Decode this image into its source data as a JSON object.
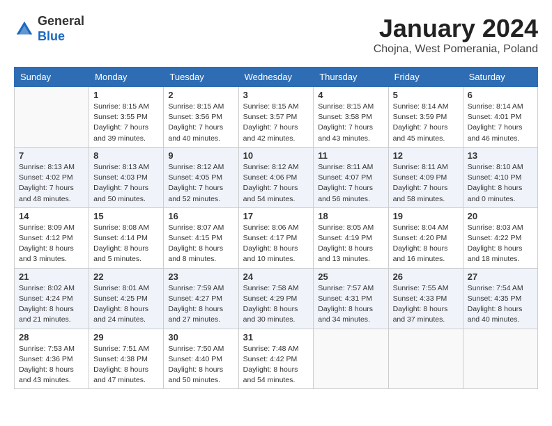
{
  "header": {
    "logo_line1": "General",
    "logo_line2": "Blue",
    "month_title": "January 2024",
    "subtitle": "Chojna, West Pomerania, Poland"
  },
  "weekdays": [
    "Sunday",
    "Monday",
    "Tuesday",
    "Wednesday",
    "Thursday",
    "Friday",
    "Saturday"
  ],
  "weeks": [
    [
      {
        "day": "",
        "info": ""
      },
      {
        "day": "1",
        "info": "Sunrise: 8:15 AM\nSunset: 3:55 PM\nDaylight: 7 hours\nand 39 minutes."
      },
      {
        "day": "2",
        "info": "Sunrise: 8:15 AM\nSunset: 3:56 PM\nDaylight: 7 hours\nand 40 minutes."
      },
      {
        "day": "3",
        "info": "Sunrise: 8:15 AM\nSunset: 3:57 PM\nDaylight: 7 hours\nand 42 minutes."
      },
      {
        "day": "4",
        "info": "Sunrise: 8:15 AM\nSunset: 3:58 PM\nDaylight: 7 hours\nand 43 minutes."
      },
      {
        "day": "5",
        "info": "Sunrise: 8:14 AM\nSunset: 3:59 PM\nDaylight: 7 hours\nand 45 minutes."
      },
      {
        "day": "6",
        "info": "Sunrise: 8:14 AM\nSunset: 4:01 PM\nDaylight: 7 hours\nand 46 minutes."
      }
    ],
    [
      {
        "day": "7",
        "info": "Sunrise: 8:13 AM\nSunset: 4:02 PM\nDaylight: 7 hours\nand 48 minutes."
      },
      {
        "day": "8",
        "info": "Sunrise: 8:13 AM\nSunset: 4:03 PM\nDaylight: 7 hours\nand 50 minutes."
      },
      {
        "day": "9",
        "info": "Sunrise: 8:12 AM\nSunset: 4:05 PM\nDaylight: 7 hours\nand 52 minutes."
      },
      {
        "day": "10",
        "info": "Sunrise: 8:12 AM\nSunset: 4:06 PM\nDaylight: 7 hours\nand 54 minutes."
      },
      {
        "day": "11",
        "info": "Sunrise: 8:11 AM\nSunset: 4:07 PM\nDaylight: 7 hours\nand 56 minutes."
      },
      {
        "day": "12",
        "info": "Sunrise: 8:11 AM\nSunset: 4:09 PM\nDaylight: 7 hours\nand 58 minutes."
      },
      {
        "day": "13",
        "info": "Sunrise: 8:10 AM\nSunset: 4:10 PM\nDaylight: 8 hours\nand 0 minutes."
      }
    ],
    [
      {
        "day": "14",
        "info": "Sunrise: 8:09 AM\nSunset: 4:12 PM\nDaylight: 8 hours\nand 3 minutes."
      },
      {
        "day": "15",
        "info": "Sunrise: 8:08 AM\nSunset: 4:14 PM\nDaylight: 8 hours\nand 5 minutes."
      },
      {
        "day": "16",
        "info": "Sunrise: 8:07 AM\nSunset: 4:15 PM\nDaylight: 8 hours\nand 8 minutes."
      },
      {
        "day": "17",
        "info": "Sunrise: 8:06 AM\nSunset: 4:17 PM\nDaylight: 8 hours\nand 10 minutes."
      },
      {
        "day": "18",
        "info": "Sunrise: 8:05 AM\nSunset: 4:19 PM\nDaylight: 8 hours\nand 13 minutes."
      },
      {
        "day": "19",
        "info": "Sunrise: 8:04 AM\nSunset: 4:20 PM\nDaylight: 8 hours\nand 16 minutes."
      },
      {
        "day": "20",
        "info": "Sunrise: 8:03 AM\nSunset: 4:22 PM\nDaylight: 8 hours\nand 18 minutes."
      }
    ],
    [
      {
        "day": "21",
        "info": "Sunrise: 8:02 AM\nSunset: 4:24 PM\nDaylight: 8 hours\nand 21 minutes."
      },
      {
        "day": "22",
        "info": "Sunrise: 8:01 AM\nSunset: 4:25 PM\nDaylight: 8 hours\nand 24 minutes."
      },
      {
        "day": "23",
        "info": "Sunrise: 7:59 AM\nSunset: 4:27 PM\nDaylight: 8 hours\nand 27 minutes."
      },
      {
        "day": "24",
        "info": "Sunrise: 7:58 AM\nSunset: 4:29 PM\nDaylight: 8 hours\nand 30 minutes."
      },
      {
        "day": "25",
        "info": "Sunrise: 7:57 AM\nSunset: 4:31 PM\nDaylight: 8 hours\nand 34 minutes."
      },
      {
        "day": "26",
        "info": "Sunrise: 7:55 AM\nSunset: 4:33 PM\nDaylight: 8 hours\nand 37 minutes."
      },
      {
        "day": "27",
        "info": "Sunrise: 7:54 AM\nSunset: 4:35 PM\nDaylight: 8 hours\nand 40 minutes."
      }
    ],
    [
      {
        "day": "28",
        "info": "Sunrise: 7:53 AM\nSunset: 4:36 PM\nDaylight: 8 hours\nand 43 minutes."
      },
      {
        "day": "29",
        "info": "Sunrise: 7:51 AM\nSunset: 4:38 PM\nDaylight: 8 hours\nand 47 minutes."
      },
      {
        "day": "30",
        "info": "Sunrise: 7:50 AM\nSunset: 4:40 PM\nDaylight: 8 hours\nand 50 minutes."
      },
      {
        "day": "31",
        "info": "Sunrise: 7:48 AM\nSunset: 4:42 PM\nDaylight: 8 hours\nand 54 minutes."
      },
      {
        "day": "",
        "info": ""
      },
      {
        "day": "",
        "info": ""
      },
      {
        "day": "",
        "info": ""
      }
    ]
  ]
}
